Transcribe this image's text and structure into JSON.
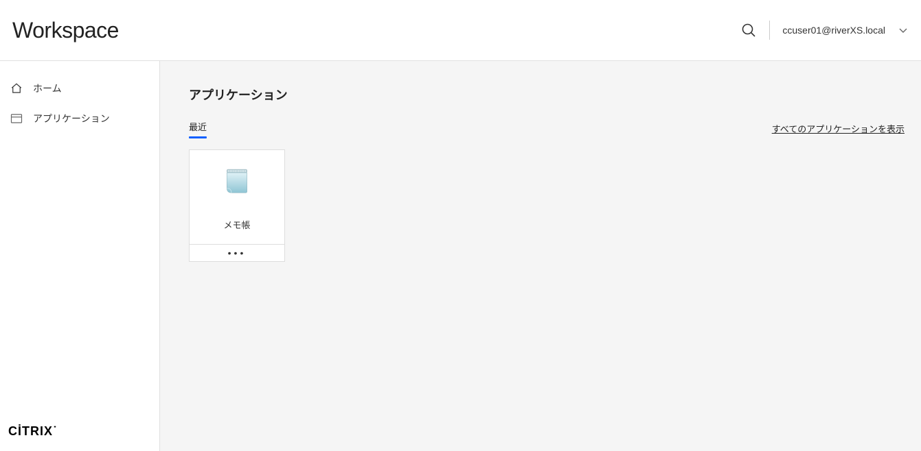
{
  "header": {
    "brand": "Workspace",
    "user": "ccuser01@riverXS.local"
  },
  "sidebar": {
    "items": [
      {
        "label": "ホーム"
      },
      {
        "label": "アプリケーション"
      }
    ],
    "footer_brand": "CİTRIX"
  },
  "main": {
    "section_title": "アプリケーション",
    "tab_recent": "最近",
    "view_all": "すべてのアプリケーションを表示",
    "apps": [
      {
        "label": "メモ帳"
      }
    ]
  }
}
